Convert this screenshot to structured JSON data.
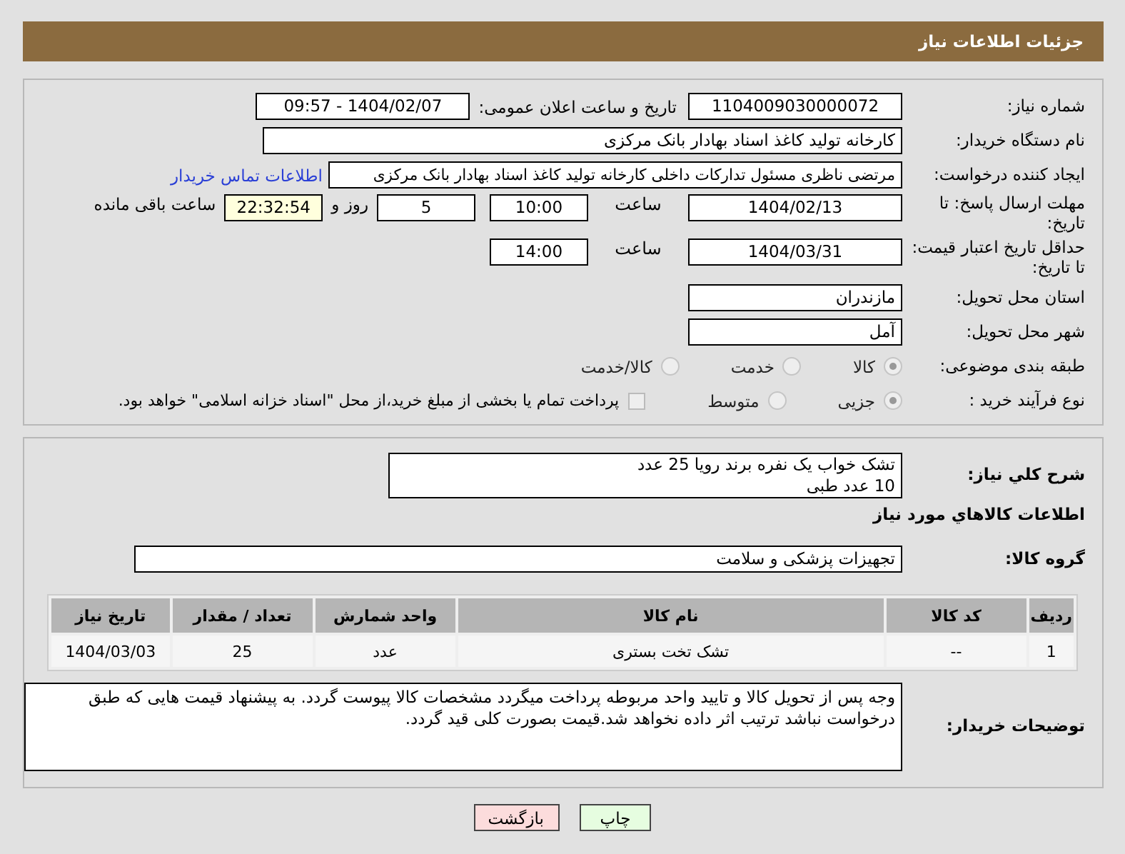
{
  "header": {
    "title": "جزئیات اطلاعات نیاز"
  },
  "need_number": {
    "label": "شماره نیاز:",
    "value": "1104009030000072"
  },
  "announce": {
    "label": "تاریخ و ساعت اعلان عمومی:",
    "value": "1404/02/07 - 09:57"
  },
  "buyer": {
    "label": "نام دستگاه خریدار:",
    "value": "کارخانه تولید کاغذ اسناد بهادار بانک مرکزی"
  },
  "creator": {
    "label": "ایجاد کننده درخواست:",
    "value": "مرتضی ناظری مسئول تدارکات داخلی کارخانه تولید کاغذ اسناد بهادار بانک مرکزی",
    "link": "اطلاعات تماس خریدار"
  },
  "deadline": {
    "label": "مهلت ارسال پاسخ: تا تاریخ:",
    "date": "1404/02/13",
    "time_label": "ساعت",
    "time": "10:00",
    "days": "5",
    "days_label": "روز و",
    "remaining": "22:32:54",
    "remaining_label": "ساعت باقی مانده"
  },
  "validity": {
    "label": "حداقل تاریخ اعتبار قیمت: تا تاریخ:",
    "date": "1404/03/31",
    "time_label": "ساعت",
    "time": "14:00"
  },
  "province": {
    "label": "استان محل تحویل:",
    "value": "مازندران"
  },
  "city": {
    "label": "شهر محل تحویل:",
    "value": "آمل"
  },
  "category": {
    "label": "طبقه بندی موضوعی:",
    "options": [
      {
        "label": "کالا",
        "selected": true
      },
      {
        "label": "خدمت",
        "selected": false
      },
      {
        "label": "کالا/خدمت",
        "selected": false
      }
    ]
  },
  "process": {
    "label": "نوع فرآیند خرید :",
    "options": [
      {
        "label": "جزیی",
        "selected": true
      },
      {
        "label": "متوسط",
        "selected": false
      }
    ],
    "treasury": {
      "label": "پرداخت تمام یا بخشی از مبلغ خرید،از محل \"اسناد خزانه اسلامی\" خواهد بود.",
      "checked": false
    }
  },
  "description": {
    "label": "شرح کلي نياز:",
    "lines": [
      "تشک خواب یک نفره برند رویا  25 عدد",
      "10 عدد طبی"
    ]
  },
  "goods_title": "اطلاعات کالاهاي مورد نياز",
  "group": {
    "label": "گروه کالا:",
    "value": "تجهیزات پزشکی و سلامت"
  },
  "table": {
    "columns": [
      "ردیف",
      "کد کالا",
      "نام کالا",
      "واحد شمارش",
      "تعداد / مقدار",
      "تاریخ نیاز"
    ],
    "rows": [
      [
        "1",
        "--",
        "تشک تخت بستری",
        "عدد",
        "25",
        "1404/03/03"
      ]
    ]
  },
  "notes": {
    "label": "توضیحات خریدار:",
    "value": "وجه پس از تحویل کالا و تایید واحد مربوطه پرداخت میگردد مشخصات کالا پیوست گردد. به پیشنهاد قیمت هایی که طبق درخواست نباشد ترتیب اثر داده نخواهد شد.قیمت بصورت کلی قید گردد."
  },
  "buttons": [
    {
      "label": "چاپ",
      "kind": "print"
    },
    {
      "label": "بازگشت",
      "kind": "back"
    }
  ]
}
